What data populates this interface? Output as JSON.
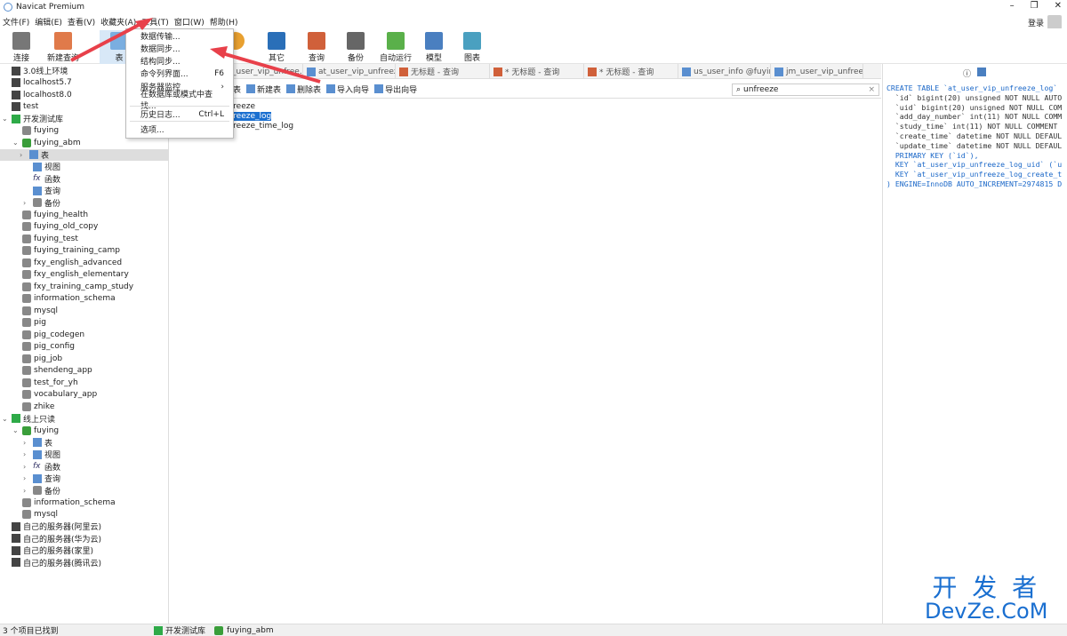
{
  "app": {
    "title": "Navicat Premium",
    "login": "登录"
  },
  "menubar": [
    "文件(F)",
    "编辑(E)",
    "查看(V)",
    "收藏夹(A)",
    "工具(T)",
    "窗口(W)",
    "帮助(H)"
  ],
  "toolbar": {
    "connect": "连接",
    "new_query": "新建查询",
    "table": "表",
    "other": "其它",
    "query": "查询",
    "backup": "备份",
    "autorun": "自动运行",
    "model": "模型",
    "chart": "图表"
  },
  "tools_menu": [
    {
      "label": "数据传输...",
      "shortcut": ""
    },
    {
      "label": "数据同步...",
      "shortcut": ""
    },
    {
      "label": "结构同步...",
      "shortcut": ""
    },
    {
      "label": "命令列界面...",
      "shortcut": "F6"
    },
    {
      "label": "服务器监控",
      "shortcut": "›"
    },
    {
      "label": "在数据库或模式中查找...",
      "shortcut": ""
    },
    {
      "label": "历史日志...",
      "shortcut": "Ctrl+L"
    },
    {
      "label": "选项...",
      "shortcut": ""
    }
  ],
  "sidebar": {
    "items": [
      "3.0线上环境",
      "localhost5.7",
      "localhost8.0",
      "test",
      "开发测试库",
      "fuying",
      "fuying_abm",
      "表",
      "视图",
      "函数",
      "查询",
      "备份",
      "fuying_health",
      "fuying_old_copy",
      "fuying_test",
      "fuying_training_camp",
      "fxy_english_advanced",
      "fxy_english_elementary",
      "fxy_training_camp_study",
      "information_schema",
      "mysql",
      "pig",
      "pig_codegen",
      "pig_config",
      "pig_job",
      "shendeng_app",
      "test_for_yh",
      "vocabulary_app",
      "zhike",
      "线上只读",
      "fuying",
      "表",
      "视图",
      "函数",
      "查询",
      "备份",
      "information_schema",
      "mysql",
      "自己的服务器(阿里云)",
      "自己的服务器(华为云)",
      "自己的服务器(家里)",
      "自己的服务器(腾讯云)"
    ]
  },
  "tabs": [
    "_user_vip_unfree...",
    "at_user_vip_unfreeze...",
    "无标题 - 查询",
    "* 无标题 - 查询",
    "* 无标题 - 查询",
    "us_user_info @fuyin...",
    "jm_user_vip_unfreez..."
  ],
  "subtoolbar": {
    "design": "计表",
    "new": "新建表",
    "delete": "删除表",
    "import": "导入向导",
    "export": "导出向导"
  },
  "search": {
    "value": "unfreeze"
  },
  "list": [
    "freeze",
    "freeze_log",
    "freeze_time_log"
  ],
  "ddl": [
    "CREATE TABLE `at_user_vip_unfreeze_log`",
    "  `id` bigint(20) unsigned NOT NULL AUTO",
    "  `uid` bigint(20) unsigned NOT NULL COM",
    "  `add_day_number` int(11) NOT NULL COMM",
    "  `study_time` int(11) NOT NULL COMMENT",
    "  `create_time` datetime NOT NULL DEFAUL",
    "  `update_time` datetime NOT NULL DEFAUL",
    "  PRIMARY KEY (`id`),",
    "  KEY `at_user_vip_unfreeze_log_uid` (`u",
    "  KEY `at_user_vip_unfreeze_log_create_t",
    ") ENGINE=InnoDB AUTO_INCREMENT=2974815 D"
  ],
  "status": {
    "found": "3 个项目已找到",
    "connection": "开发测试库",
    "database": "fuying_abm"
  },
  "watermark": {
    "cn": "开 发 者",
    "en": "DevZe.CoM"
  }
}
